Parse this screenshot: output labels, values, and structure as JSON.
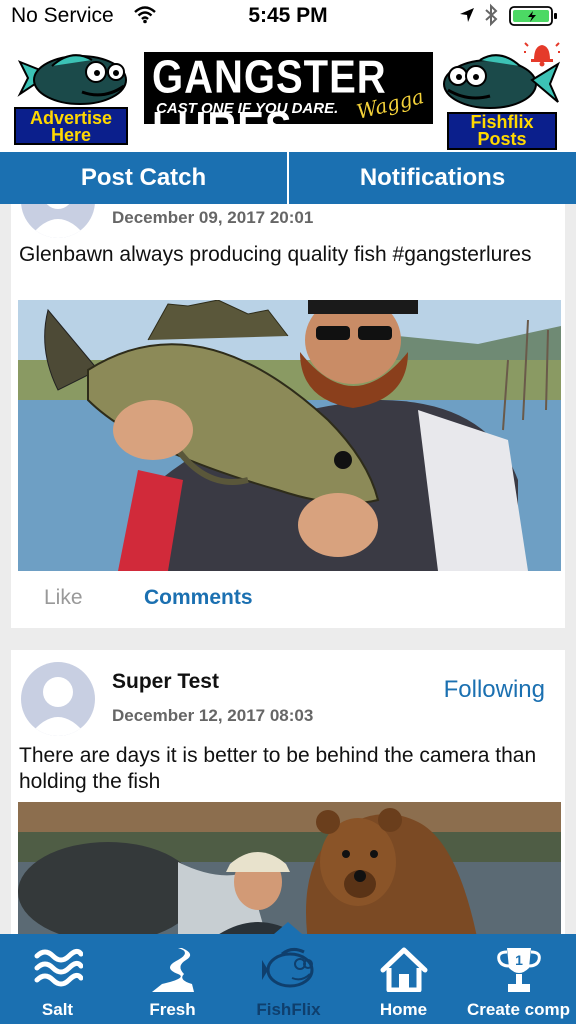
{
  "status_bar": {
    "carrier": "No Service",
    "time": "5:45 PM",
    "battery_color": "#4cd964"
  },
  "header": {
    "left_ad_label": "Advertise Here",
    "logo_title": "GANGSTER LURES",
    "logo_subtitle": "CAST ONE IF YOU DARE.",
    "logo_script": "Wagga",
    "right_ad_label": "Fishflix Posts",
    "brand_yellow": "#ffd800",
    "brand_navy": "#0b1f8c"
  },
  "tabs": [
    {
      "label": "Post Catch"
    },
    {
      "label": "Notifications"
    }
  ],
  "feed": {
    "posts": [
      {
        "date": "December 09, 2017 20:01",
        "caption": "Glenbawn always producing quality fish #gangsterlures",
        "like_label": "Like",
        "comments_label": "Comments"
      },
      {
        "author": "Super Test",
        "date": "December 12, 2017 08:03",
        "follow_label": "Following",
        "caption": "There are days it is better to be behind the camera than holding the fish"
      }
    ]
  },
  "bottom_nav": {
    "accent": "#1b70b1",
    "items": [
      {
        "label": "Salt",
        "icon": "waves-icon"
      },
      {
        "label": "Fresh",
        "icon": "river-icon"
      },
      {
        "label": "FishFlix",
        "icon": "fish-icon"
      },
      {
        "label": "Home",
        "icon": "home-icon"
      },
      {
        "label": "Create comp",
        "icon": "trophy-icon"
      }
    ]
  }
}
